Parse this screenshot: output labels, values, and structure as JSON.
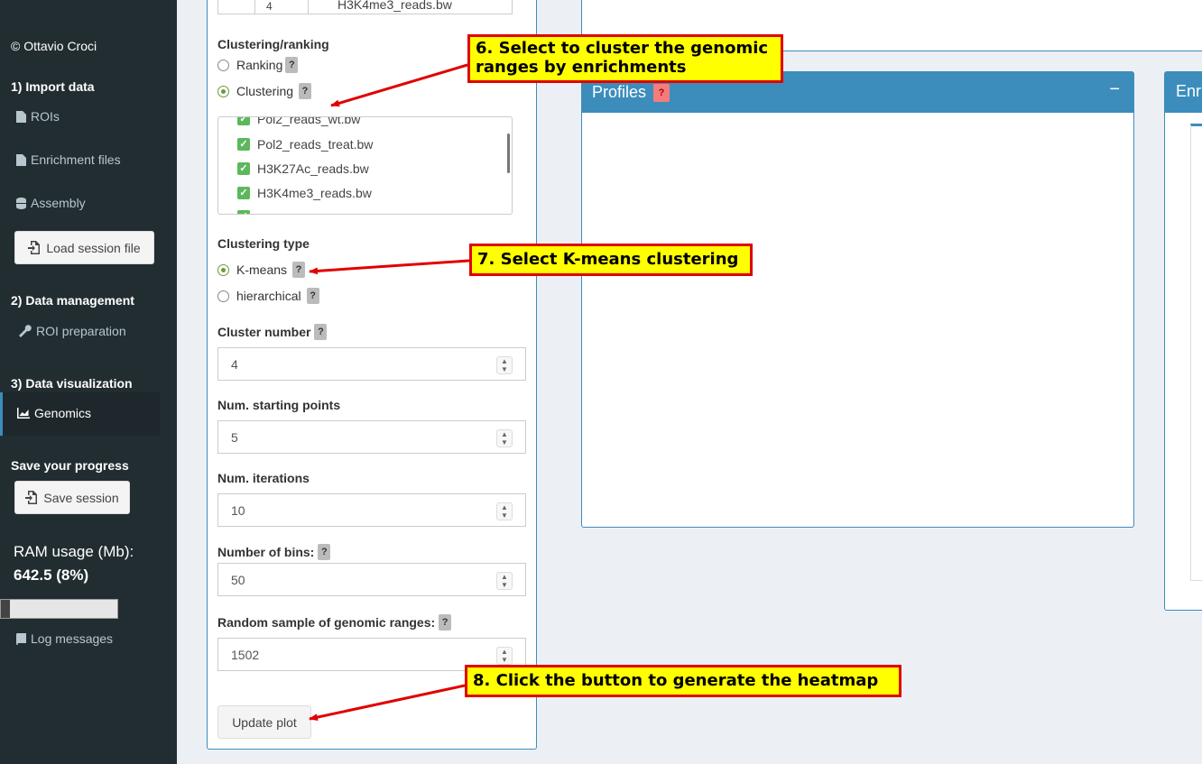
{
  "sidebar": {
    "copyright": "© Ottavio Croci",
    "sections": [
      {
        "title": "1) Import data",
        "items": [
          {
            "label": "ROIs",
            "icon": "file-icon"
          },
          {
            "label": "Enrichment files",
            "icon": "file-icon"
          },
          {
            "label": "Assembly",
            "icon": "database-icon"
          }
        ]
      },
      {
        "title": "2) Data management",
        "items": [
          {
            "label": "ROI preparation",
            "icon": "wrench-icon"
          }
        ]
      },
      {
        "title": "3) Data visualization",
        "items": [
          {
            "label": "Genomics",
            "icon": "chart-icon",
            "active": true
          }
        ]
      }
    ],
    "load_session_label": "Load session file",
    "save_title": "Save your progress",
    "save_session_label": "Save session",
    "ram_label": "RAM usage (Mb):",
    "ram_value": "642.5 (8%)",
    "ram_fraction": 0.08,
    "log_label": "Log messages"
  },
  "controls": {
    "top_select": {
      "number": "4",
      "filename": "H3K4me3_reads.bw"
    },
    "clustering_ranking_label": "Clustering/ranking",
    "ranking_label": "Ranking",
    "clustering_label": "Clustering",
    "enrichment_files": [
      "Pol2_reads_wt.bw",
      "Pol2_reads_treat.bw",
      "H3K27Ac_reads.bw",
      "H3K4me3_reads.bw"
    ],
    "clustering_type_label": "Clustering type",
    "kmeans_label": "K-means",
    "hierarchical_label": "hierarchical",
    "cluster_number_label": "Cluster number",
    "cluster_number": "4",
    "starting_points_label": "Num. starting points",
    "starting_points": "5",
    "iterations_label": "Num. iterations",
    "iterations": "10",
    "bins_label": "Number of bins:",
    "bins": "50",
    "random_sample_label": "Random sample of genomic ranges:",
    "random_sample": "1502",
    "update_label": "Update plot",
    "help_glyph": "?"
  },
  "panels": {
    "profiles_title": "Profiles",
    "profiles_help": "?",
    "collapse_glyph": "−",
    "enrichment_title": "Enri"
  },
  "annotations": {
    "step6_line1": "6. Select to cluster the genomic",
    "step6_line2": "ranges by enrichments",
    "step7": "7. Select K-means clustering",
    "step8": "8. Click the button to generate the heatmap",
    "colors": {
      "fill": "#ffff00",
      "border": "#e00000"
    }
  },
  "colors": {
    "sidebar_bg": "#222d32",
    "accent": "#3c8dbc",
    "check": "#5cb85c"
  }
}
